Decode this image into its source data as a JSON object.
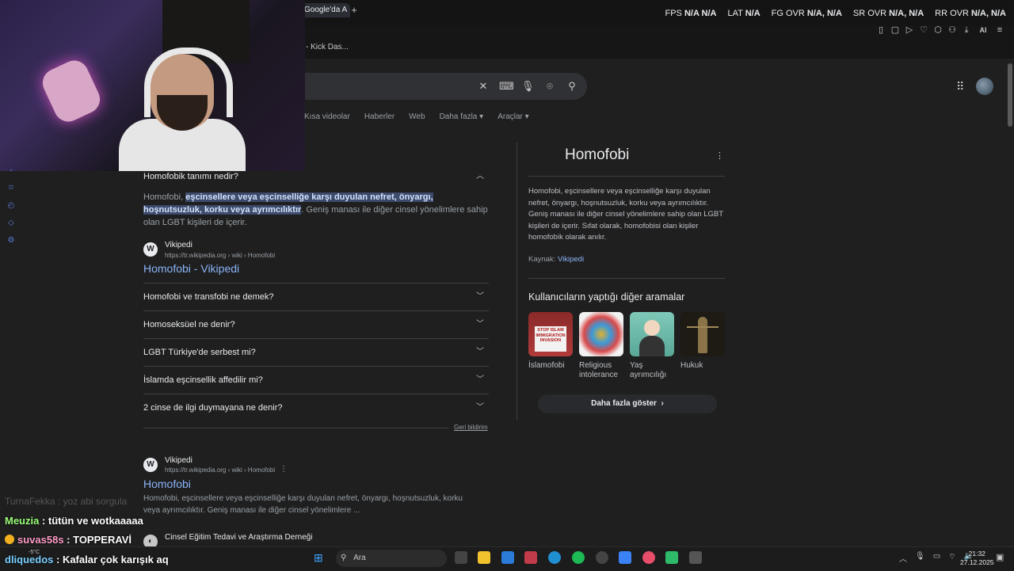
{
  "browser": {
    "tab_title": "Google'da A",
    "tab_plus": "+",
    "bookmark": "- Kick Das...",
    "stats": [
      {
        "label": "FPS",
        "value": "N/A  N/A"
      },
      {
        "label": "LAT",
        "value": "N/A"
      },
      {
        "label": "FG OVR",
        "value": "N/A,  N/A"
      },
      {
        "label": "SR OVR",
        "value": "N/A,  N/A"
      },
      {
        "label": "RR OVR",
        "value": "N/A,  N/A"
      }
    ],
    "ai_label": "AI"
  },
  "search": {
    "tabs": [
      "Kısa videolar",
      "Haberler",
      "Web",
      "Daha fazla",
      "Araçlar"
    ]
  },
  "accordion": {
    "open_question": "Homofobik tanımı nedir?",
    "answer_before": "Homofobi, ",
    "answer_highlight": "eşcinsellere veya eşcinselliğe karşı duyulan nefret, önyargı, hoşnutsuzluk, korku veya ayrımcılıktır",
    "answer_after": ". Geniş manası ile diğer cinsel yönelimlere sahip olan LGBT kişileri de içerir.",
    "source_name": "Vikipedi",
    "source_url": "https://tr.wikipedia.org › wiki › Homofobi",
    "source_title": "Homofobi - Vikipedi",
    "questions": [
      "Homofobi ve transfobi ne demek?",
      "Homoseksüel ne denir?",
      "LGBT Türkiye'de serbest mi?",
      "İslamda eşcinsellik affedilir mi?",
      "2 cinse de ilgi duymayana ne denir?"
    ],
    "feedback": "Geri bildirim"
  },
  "result": {
    "source_name": "Vikipedi",
    "source_url": "https://tr.wikipedia.org › wiki › Homofobi",
    "title": "Homofobi",
    "description": "Homofobi, eşcinsellere veya eşcinselliğe karşı duyulan nefret, önyargı, hoşnutsuzluk, korku veya ayrımcılıktır. Geniş manası ile diğer cinsel yönelimlere ...",
    "next_source": "Cinsel Eğitim Tedavi ve Araştırma Derneği"
  },
  "knowledge_panel": {
    "title": "Homofobi",
    "description": "Homofobi, eşcinsellere veya eşcinselliğe karşı duyulan nefret, önyargı, hoşnutsuzluk, korku veya ayrımcılıktır. Geniş manası ile diğer cinsel yönelimlere sahip olan LGBT kişileri de içerir. Sıfat olarak, homofobisi olan kişiler homofobik olarak anılır.",
    "source_label": "Kaynak: ",
    "source_link": "Vikipedi",
    "also_searched": "Kullanıcıların yaptığı diğer aramalar",
    "related": [
      {
        "label": "İslamofobi",
        "color": "#b23a3a"
      },
      {
        "label": "Religious intolerance",
        "color": "#e0b030"
      },
      {
        "label": "Yaş ayrımcılığı",
        "color": "#7fc9b8"
      },
      {
        "label": "Hukuk",
        "color": "#3a3226"
      }
    ],
    "related_sign": "STOP ISLAM IMMIGRATION INVASION",
    "more_button": "Daha fazla göster"
  },
  "chat": {
    "faded": "TurnaFekka : yoz abi sorgula",
    "line1_user": "Meuzia",
    "line1_msg": " : tütün ve wotkaaaaa",
    "line2_user": "suvas58s",
    "line2_msg": " : TOPPERAVİ",
    "line3_user": "dliquedos",
    "line3_msg": " : Kafalar çok karışık aq"
  },
  "taskbar": {
    "search_placeholder": "Ara",
    "temperature": "-5°C",
    "time": "21:32",
    "date": "27.12.2025"
  }
}
